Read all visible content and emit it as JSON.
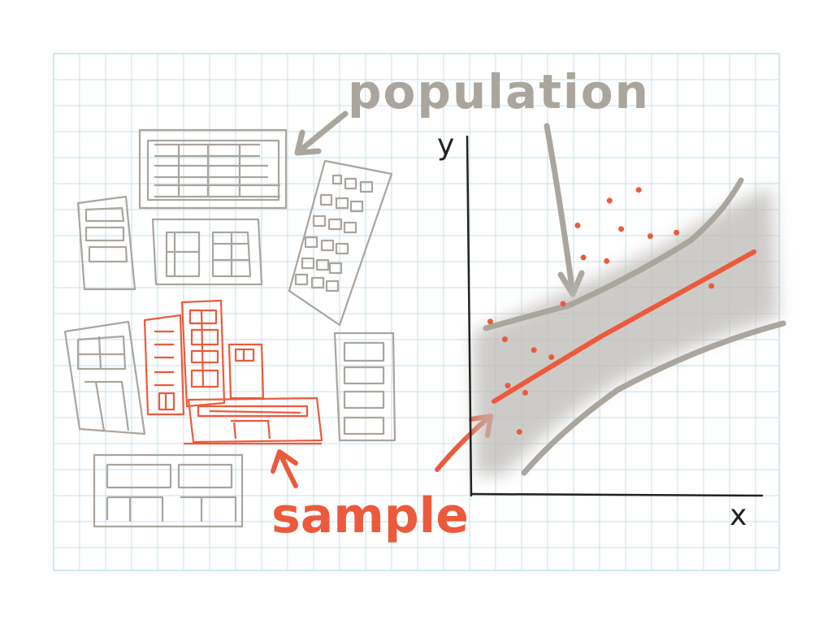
{
  "labels": {
    "population": "population",
    "sample": "sample",
    "y_axis": "y",
    "x_axis": "x"
  },
  "colors": {
    "grid": "#bfe0ea",
    "gray": "#aaa59d",
    "dark_gray": "#8e8982",
    "red": "#ec5a3c",
    "axis": "#222222",
    "band": "#bdbab5"
  },
  "chart_data": {
    "type": "scatter",
    "xlabel": "x",
    "ylabel": "y",
    "points": [
      [
        12,
        30
      ],
      [
        18,
        28
      ],
      [
        16,
        17
      ],
      [
        6,
        48
      ],
      [
        11,
        43
      ],
      [
        21,
        40
      ],
      [
        27,
        38
      ],
      [
        31,
        53
      ],
      [
        36,
        75
      ],
      [
        38,
        66
      ],
      [
        47,
        82
      ],
      [
        51,
        74
      ],
      [
        61,
        72
      ],
      [
        70,
        73
      ],
      [
        46,
        65
      ],
      [
        57,
        85
      ],
      [
        82,
        58
      ]
    ]
  }
}
